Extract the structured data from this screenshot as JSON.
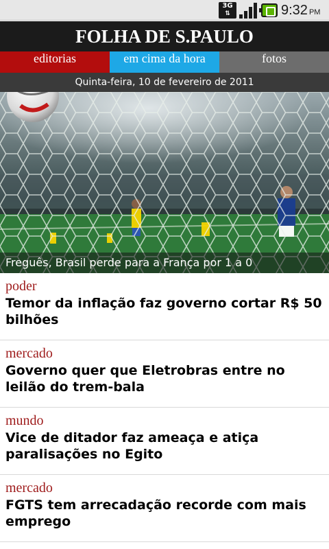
{
  "statusbar": {
    "network": "3G",
    "time": "9:32",
    "ampm": "PM",
    "icons": [
      "3g-data-icon",
      "signal-icon",
      "battery-icon"
    ]
  },
  "app": {
    "title": "FOLHA DE S.PAULO"
  },
  "tabs": [
    {
      "label": "editorias",
      "color": "#b30d0d"
    },
    {
      "label": "em cima da hora",
      "color": "#1ea8e6"
    },
    {
      "label": "fotos",
      "color": "#6d6d6d"
    }
  ],
  "date": "Quinta-feira, 10 de fevereiro de 2011",
  "hero": {
    "caption": "Freguês, Brasil perde para a França por 1 a 0"
  },
  "news": [
    {
      "section": "poder",
      "headline": "Temor da inflação faz governo cortar R$ 50 bilhões"
    },
    {
      "section": "mercado",
      "headline": "Governo quer que Eletrobras entre no leilão do trem-bala"
    },
    {
      "section": "mundo",
      "headline": "Vice de ditador faz ameaça e atiça paralisações no Egito"
    },
    {
      "section": "mercado",
      "headline": "FGTS tem arrecadação recorde com mais emprego"
    }
  ],
  "colors": {
    "section_text": "#9e1b1b",
    "masthead_bg": "#1b1b1b",
    "dateline_bg": "#3a3a3a"
  }
}
